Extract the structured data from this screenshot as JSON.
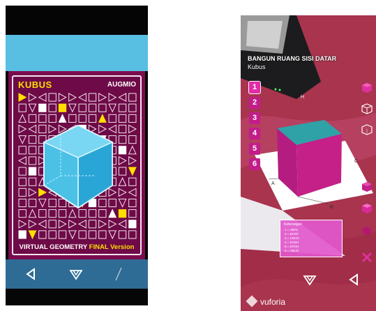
{
  "left_phone": {
    "title": "KUBUS",
    "brand": "AUGMIO",
    "footer_main": "VIRTUAL GEOMETRY ",
    "footer_accent": "FINAL Version",
    "nav": {
      "back_icon": "back-triangle-icon",
      "home_icon": "home-logo-icon"
    }
  },
  "right_phone": {
    "title": "BANGUN RUANG SISI DATAR",
    "subtitle": "Kubus",
    "number_buttons": [
      "1",
      "2",
      "3",
      "4",
      "5",
      "6"
    ],
    "active_number": "1",
    "marker_labels": [
      "A",
      "B",
      "C",
      "H"
    ],
    "legend": {
      "title": "Keterangan",
      "items": [
        "1 = ABFE",
        "2 = BCGF",
        "3 = CDHG",
        "4 = DAEH",
        "5 = EFGH",
        "6 = ABCD"
      ]
    },
    "side_icons": [
      "net-cube-icon",
      "wireframe-cube-icon",
      "outline-cube-icon",
      "solid-cube-icon",
      "pink-cube-icon",
      "small-cube-icon",
      "cube-icon",
      "close-x-icon"
    ],
    "vuforia_label": "vuforia",
    "nav": {
      "home_icon": "home-logo-icon",
      "back_icon": "back-triangle-icon"
    }
  },
  "colors": {
    "cube_cyan": "#4bc1e6",
    "card_magenta": "#7a0c4e",
    "accent_yellow": "#ffde00",
    "ar_pink": "#c21d8a",
    "ar_cube_top": "#2fa2a8",
    "ar_cube_side": "#c42088"
  }
}
